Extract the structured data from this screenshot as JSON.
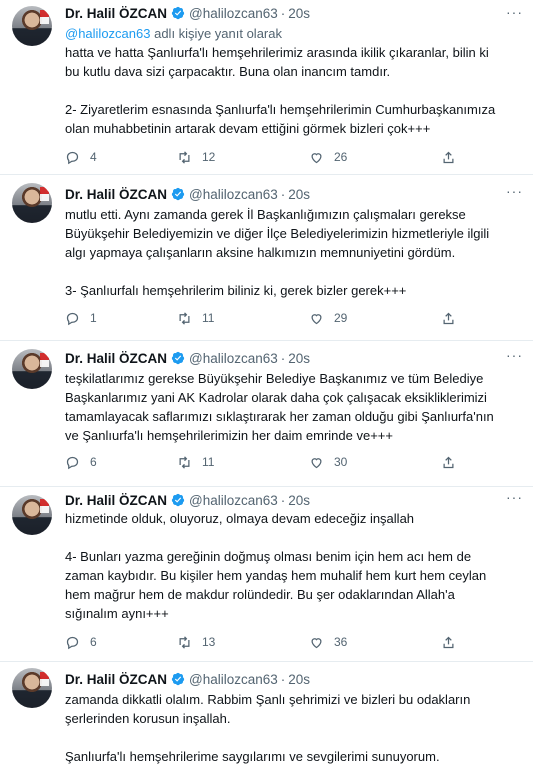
{
  "author": {
    "name": "Dr. Halil ÖZCAN",
    "handle": "@halilozcan63",
    "time_sep": "·",
    "time": "20s"
  },
  "more_label": "···",
  "tweets": [
    {
      "reply_mention": "@halilozcan63",
      "reply_text": " adlı kişiye yanıt olarak",
      "lines": [
        "hatta ve hatta Şanlıurfa'lı hemşehrilerimiz arasında ikilik çıkaranlar, bilin ki",
        "bu kutlu dava sizi çarpacaktır. Buna olan inancım tamdır.",
        "",
        "2- Ziyaretlerim esnasında Şanlıurfa'lı hemşehrilerimin Cumhurbaşkanımıza",
        "olan muhabbetinin artarak devam ettiğini görmek bizleri çok+++"
      ],
      "replies": "4",
      "retweets": "12",
      "likes": "26"
    },
    {
      "lines": [
        "mutlu etti. Aynı zamanda gerek İl Başkanlığımızın çalışmaları gerekse",
        "Büyükşehir Belediyemizin ve diğer İlçe Belediyelerimizin hizmetleriyle ilgili",
        "algı yapmaya çalışanların aksine halkımızın memnuniyetini gördüm.",
        "",
        "3- Şanlıurfalı hemşehrilerim biliniz ki, gerek bizler gerek+++"
      ],
      "replies": "1",
      "retweets": "11",
      "likes": "29"
    },
    {
      "lines": [
        "teşkilatlarımız gerekse Büyükşehir Belediye Başkanımız ve tüm Belediye",
        "Başkanlarımız yani AK Kadrolar olarak daha çok çalışacak eksikliklerimizi",
        "tamamlayacak saflarımızı sıklaştırarak her zaman olduğu gibi Şanlıurfa'nın",
        "ve Şanlıurfa'lı hemşehrilerimizin her daim emrinde ve+++"
      ],
      "replies": "6",
      "retweets": "11",
      "likes": "30"
    },
    {
      "lines": [
        "hizmetinde olduk, oluyoruz, olmaya devam edeceğiz inşallah",
        "",
        "4- Bunları yazma gereğinin doğmuş olması benim için hem acı hem de",
        "zaman kaybıdır. Bu kişiler hem yandaş hem muhalif hem kurt hem ceylan",
        "hem mağrur hem de makdur rolündedir. Bu şer odaklarından Allah'a",
        "sığınalım aynı+++"
      ],
      "replies": "6",
      "retweets": "13",
      "likes": "36"
    },
    {
      "lines": [
        "zamanda dikkatli olalım. Rabbim Şanlı şehrimizi ve bizleri bu odakların",
        "şerlerinden korusun inşallah.",
        "",
        "Şanlıurfa'lı hemşehrilerime saygılarımı ve sevgilerimi sunuyorum."
      ]
    }
  ]
}
